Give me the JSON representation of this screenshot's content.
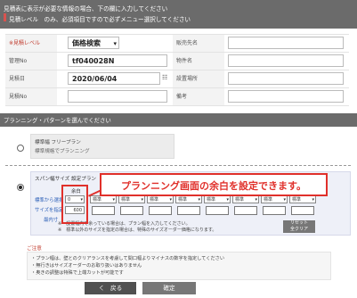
{
  "header": {
    "line1": "見積表に表示が必要な情報の場合、下の欄に入力してください",
    "line2": "見積レベル　のみ、必須項目ですので必ずメニュー選択してください"
  },
  "form": {
    "level_label": "見積レベル",
    "level_star": "※",
    "level_value": "価格検索",
    "kanri_label": "管理No",
    "kanri_value": "tf040028N",
    "date_label": "見積日",
    "date_value": "2020/06/04",
    "date_icon": "calendar-icon",
    "mitsumori_label": "見積No",
    "hanbai_label": "販売先名",
    "bukken_label": "物件名",
    "setchi_label": "設置場所",
    "bikou_label": "備考"
  },
  "section": {
    "title": "プランニング・パターンを選んでください"
  },
  "free_plan": {
    "title": "標準幅 フリープラン",
    "sub": "標準規格でプランニング"
  },
  "span_panel": {
    "title": "スパン幅サイズ 設定プラン",
    "margin_label": "余白",
    "row1_label": "標準から選択",
    "row1_value": "0",
    "row2_label": "サイズを指定",
    "row2_value": "600",
    "row3_label": "最内寸",
    "std_label": "標準",
    "std_count": 8,
    "note1": "※　設置幅内で余っている場合は、プラン幅を入力してください。",
    "note2": "※　標準以外のサイズを指定の場合は、特殊のサイズオーダー価格になります。",
    "reset_label": "リセット\n全クリア"
  },
  "callout": {
    "text": "プランニング画面の余白を設定できます。",
    "color": "#e0302b"
  },
  "caution": {
    "title": "ご注意",
    "lines": [
      "・プラン幅は、壁とのクリアランスを考慮して間口幅よりマイナスの数字を指定してください",
      "・無行きはサイズオーダーのお取り扱いはありません",
      "・奥きの調整は特殊で上端カットが可能です"
    ]
  },
  "buttons": {
    "back": "く　戻る",
    "confirm": "確定"
  }
}
